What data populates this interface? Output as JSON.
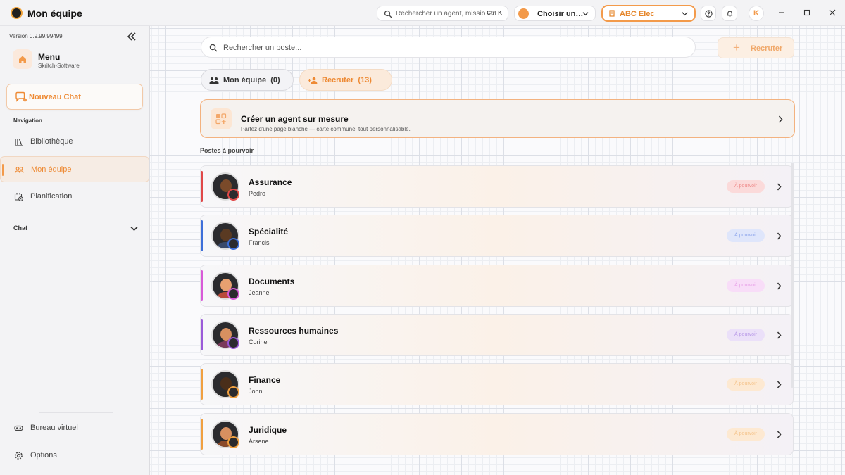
{
  "app": {
    "title": "Mon équipe",
    "search_placeholder": "Rechercher un agent, missio…",
    "search_shortcut": "Ctrl K",
    "agent_select": "Choisir un…",
    "company_select": "ABC Elec",
    "user_initial": "K",
    "accent": "#f39a4a"
  },
  "sidebar": {
    "version": "Version 0.9.99.99499",
    "menu_title": "Menu",
    "menu_subtitle": "Skritch-Software",
    "new_chat": "Nouveau Chat",
    "nav_heading": "Navigation",
    "items": [
      {
        "label": "Bibliothèque",
        "icon": "library-icon",
        "active": false
      },
      {
        "label": "Mon équipe",
        "icon": "team-icon",
        "active": true
      },
      {
        "label": "Planification",
        "icon": "calendar-clock-icon",
        "active": false
      }
    ],
    "chat_heading": "Chat",
    "bottom_items": [
      {
        "label": "Bureau virtuel",
        "icon": "vr-headset-icon"
      },
      {
        "label": "Options",
        "icon": "gear-icon"
      }
    ]
  },
  "main": {
    "search_placeholder": "Rechercher un poste...",
    "recruit_button": "Recruter",
    "tabs": [
      {
        "label": "Mon équipe  (0)",
        "active": false
      },
      {
        "label": "Recruter  (13)",
        "active": true
      }
    ],
    "custom_agent": {
      "title": "Créer un agent sur mesure",
      "subtitle": "Partez d'une page blanche — carte commune, tout personnalisable."
    },
    "section_label": "Postes à pourvoir",
    "roles": [
      {
        "name": "Assurance",
        "agent": "Pedro",
        "status": "À pourvoir",
        "color": "#e04848",
        "status_bg": "#fbdada",
        "status_fg": "#ee8a8a",
        "face": "#7a4a2a",
        "body": "#2a2a2a"
      },
      {
        "name": "Spécialité",
        "agent": "Francis",
        "status": "À pourvoir",
        "color": "#3d6fd9",
        "status_bg": "#dfe6fb",
        "status_fg": "#8ea6ec",
        "face": "#5a3a22",
        "body": "#3a4a6a"
      },
      {
        "name": "Documents",
        "agent": "Jeanne",
        "status": "À pourvoir",
        "color": "#d85ad8",
        "status_bg": "#f8ddf8",
        "status_fg": "#e8a2e8",
        "face": "#e8a070",
        "body": "#b84a3a"
      },
      {
        "name": "Ressources humaines",
        "agent": "Corine",
        "status": "À pourvoir",
        "color": "#9a5ad8",
        "status_bg": "#ebe0f9",
        "status_fg": "#b99ae8",
        "face": "#d89060",
        "body": "#7a3a5a"
      },
      {
        "name": "Finance",
        "agent": "John",
        "status": "À pourvoir",
        "color": "#f0a040",
        "status_bg": "#fde9d2",
        "status_fg": "#f5c48c",
        "face": "#4a2e1a",
        "body": "#2a2a2a"
      },
      {
        "name": "Juridique",
        "agent": "Arsene",
        "status": "À pourvoir",
        "color": "#f0a040",
        "status_bg": "#fde9d2",
        "status_fg": "#f5c48c",
        "face": "#d89060",
        "body": "#8a4a2a"
      }
    ]
  }
}
